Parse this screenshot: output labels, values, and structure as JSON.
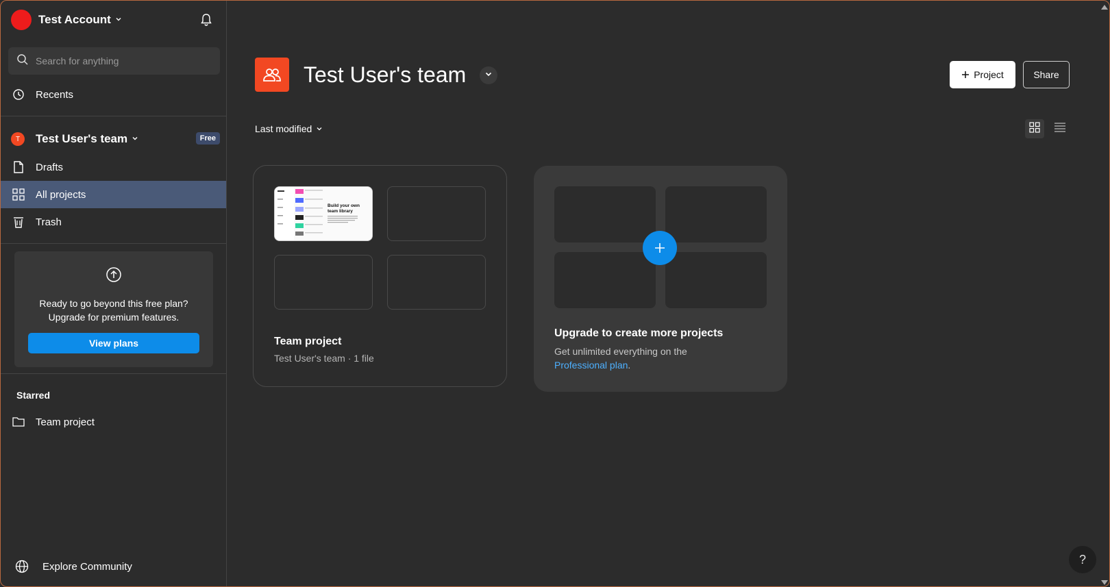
{
  "account": {
    "name": "Test Account",
    "avatar_color": "#ee1c1c"
  },
  "search": {
    "placeholder": "Search for anything"
  },
  "nav": {
    "recents": "Recents",
    "team": {
      "name": "Test User's team",
      "initial": "T",
      "badge": "Free"
    },
    "drafts": "Drafts",
    "all_projects": "All projects",
    "trash": "Trash"
  },
  "upgrade_panel": {
    "line1": "Ready to go beyond this free plan?",
    "line2": "Upgrade for premium features.",
    "button": "View plans"
  },
  "starred": {
    "title": "Starred",
    "items": [
      {
        "label": "Team project"
      }
    ]
  },
  "footer": {
    "explore": "Explore Community"
  },
  "main": {
    "title": "Test User's team",
    "buttons": {
      "project": "Project",
      "share": "Share"
    },
    "sort_label": "Last modified",
    "project_card": {
      "name": "Team project",
      "meta": "Test User's team · 1 file",
      "thumb_title": "Build your own team library"
    },
    "upgrade_card": {
      "title": "Upgrade to create more projects",
      "desc": "Get unlimited everything on the",
      "link": "Professional plan",
      "suffix": "."
    }
  },
  "help": "?",
  "colors": {
    "accent": "#0d8ce9",
    "team": "#f24822",
    "active_nav": "#4a5a78"
  }
}
